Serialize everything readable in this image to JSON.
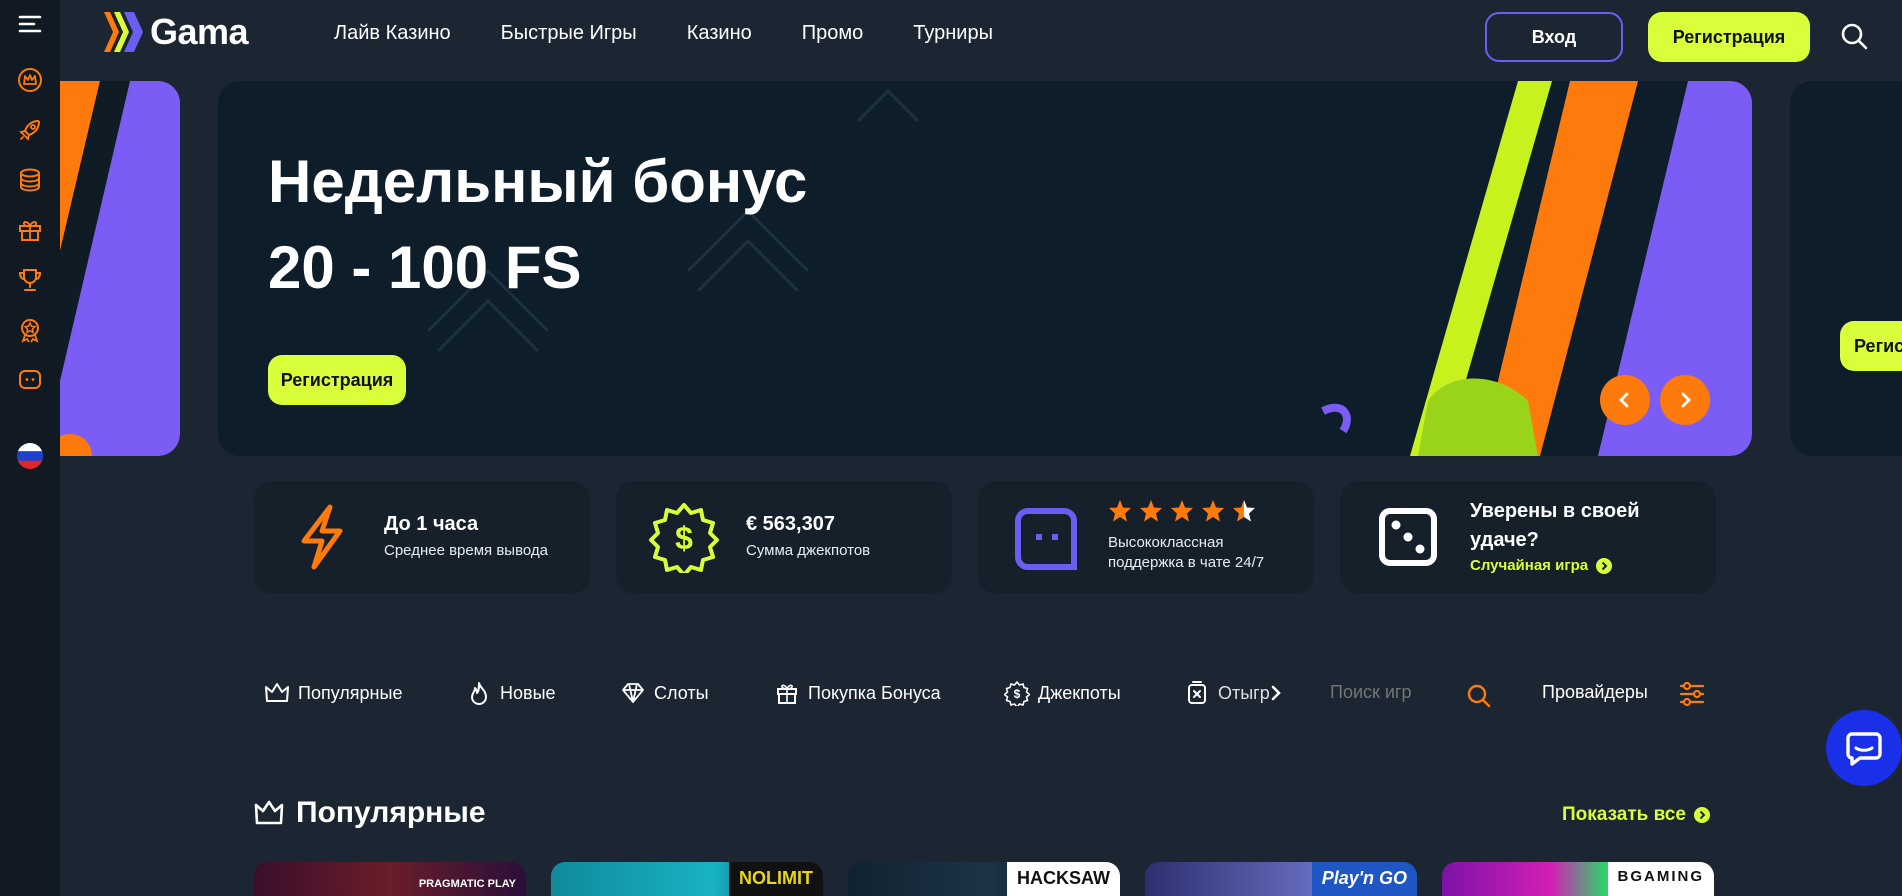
{
  "brand": {
    "name": "Gama",
    "accent": "#d9ff3a",
    "orange": "#ff7a0d",
    "purple": "#6a5ef0"
  },
  "sidebar": {
    "items": [
      {
        "icon": "menu-icon"
      },
      {
        "icon": "crown-icon"
      },
      {
        "icon": "rocket-icon"
      },
      {
        "icon": "coins-stack-icon"
      },
      {
        "icon": "gift-icon"
      },
      {
        "icon": "trophy-icon"
      },
      {
        "icon": "medal-icon"
      },
      {
        "icon": "chat-bubble-icon"
      },
      {
        "icon": "russia-flag-icon"
      }
    ]
  },
  "header": {
    "nav": [
      "Лайв Казино",
      "Быстрые Игры",
      "Казино",
      "Промо",
      "Турниры"
    ],
    "login_label": "Вход",
    "register_label": "Регистрация"
  },
  "banner": {
    "title_line1": "Недельный бонус",
    "title_line2": "20 - 100 FS",
    "button_label": "Регистрация",
    "right_button_label": "Регис"
  },
  "features": [
    {
      "title": "До 1 часа",
      "subtitle": "Среднее время вывода",
      "icon": "lightning-icon"
    },
    {
      "title": "€  563,307",
      "subtitle": "Сумма джекпотов",
      "icon": "dollar-badge-icon"
    },
    {
      "rating": 4.5,
      "subtitle_line1": "Высококлассная",
      "subtitle_line2": "поддержка в чате 24/7",
      "icon": "chat-face-icon"
    },
    {
      "title_line1": "Уверены в своей",
      "title_line2": "удаче?",
      "link": "Случайная игра",
      "icon": "dice-icon"
    }
  ],
  "categories": [
    {
      "label": "Популярные",
      "icon": "crown-icon"
    },
    {
      "label": "Новые",
      "icon": "flame-icon"
    },
    {
      "label": "Слоты",
      "icon": "diamond-icon"
    },
    {
      "label": "Покупка Бонуса",
      "icon": "gift-icon"
    },
    {
      "label": "Джекпоты",
      "icon": "dollar-gear-icon"
    },
    {
      "label": "Отыгр",
      "icon": "timer-icon"
    }
  ],
  "search": {
    "placeholder": "Поиск игр"
  },
  "providers_label": "Провайдеры",
  "section": {
    "title": "Популярные",
    "show_all": "Показать все"
  },
  "games": [
    {
      "provider": "PRAGMATIC PLAY"
    },
    {
      "provider": "NOLIMIT"
    },
    {
      "provider": "HACKSAW"
    },
    {
      "provider": "Play'n GO"
    },
    {
      "provider": "BGAMING"
    }
  ]
}
